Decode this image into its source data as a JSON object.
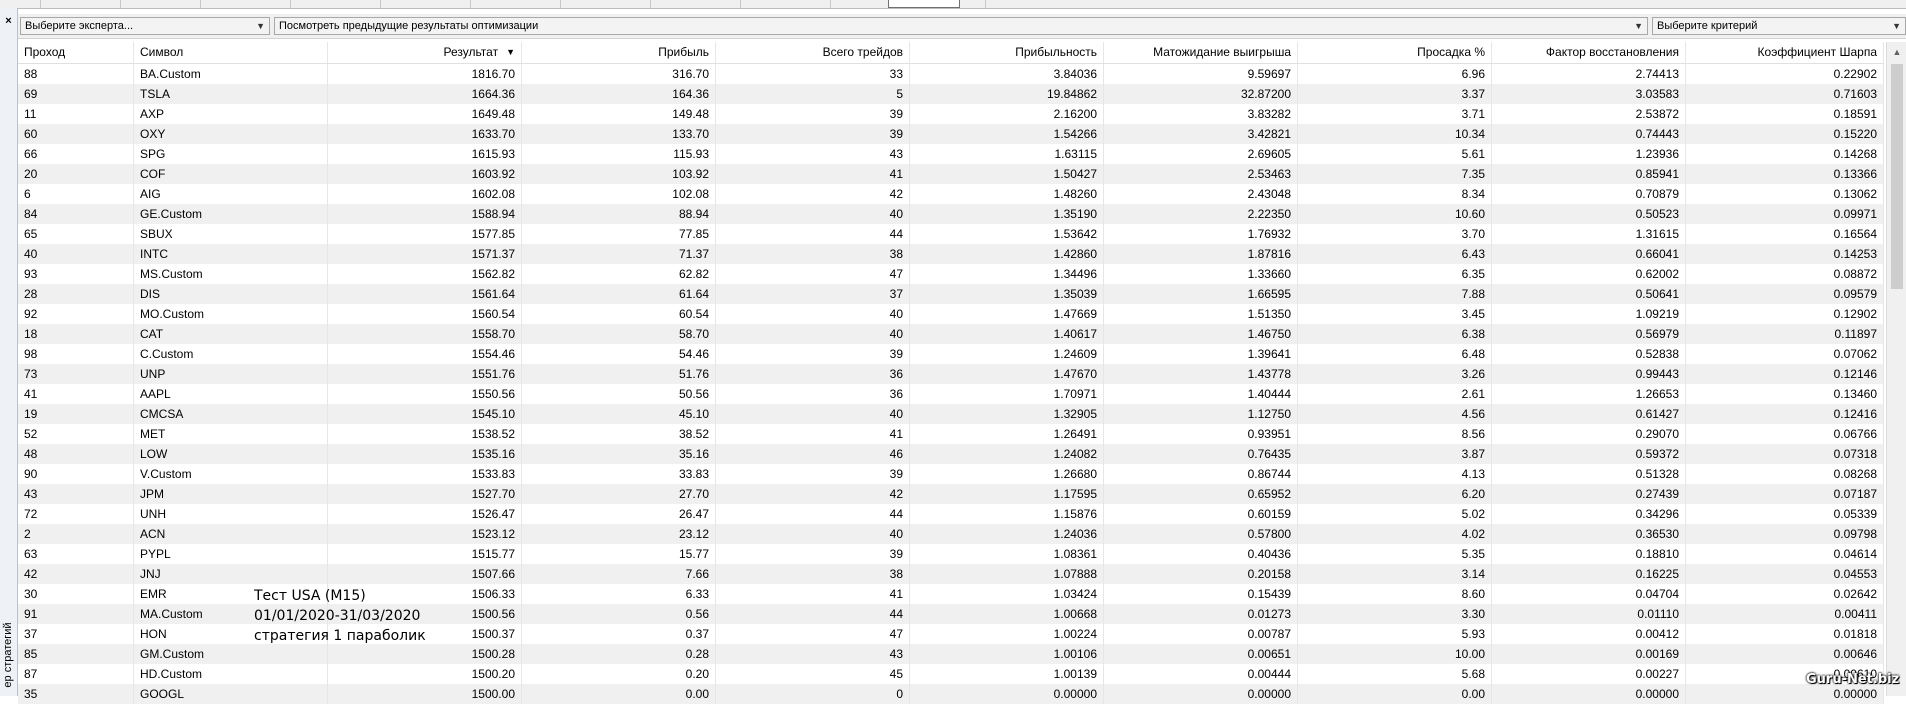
{
  "toolbar": {
    "expert_select": "Выберите эксперта...",
    "results_select": "Посмотреть предыдущие результаты оптимизации",
    "criterion_select": "Выберите критерий"
  },
  "left_panel": {
    "close_glyph": "×",
    "vertical_title": "ер стратегий"
  },
  "table": {
    "headers": [
      "Проход",
      "Символ",
      "Результат",
      "Прибыль",
      "Всего трейдов",
      "Прибыльность",
      "Матожидание выигрыша",
      "Просадка %",
      "Фактор восстановления",
      "Коэффициент Шарпа"
    ],
    "sort_indicator": "▼",
    "rows": [
      [
        "88",
        "BA.Custom",
        "1816.70",
        "316.70",
        "33",
        "3.84036",
        "9.59697",
        "6.96",
        "2.74413",
        "0.22902"
      ],
      [
        "69",
        "TSLA",
        "1664.36",
        "164.36",
        "5",
        "19.84862",
        "32.87200",
        "3.37",
        "3.03583",
        "0.71603"
      ],
      [
        "11",
        "AXP",
        "1649.48",
        "149.48",
        "39",
        "2.16200",
        "3.83282",
        "3.71",
        "2.53872",
        "0.18591"
      ],
      [
        "60",
        "OXY",
        "1633.70",
        "133.70",
        "39",
        "1.54266",
        "3.42821",
        "10.34",
        "0.74443",
        "0.15220"
      ],
      [
        "66",
        "SPG",
        "1615.93",
        "115.93",
        "43",
        "1.63115",
        "2.69605",
        "5.61",
        "1.23936",
        "0.14268"
      ],
      [
        "20",
        "COF",
        "1603.92",
        "103.92",
        "41",
        "1.50427",
        "2.53463",
        "7.35",
        "0.85941",
        "0.13366"
      ],
      [
        "6",
        "AIG",
        "1602.08",
        "102.08",
        "42",
        "1.48260",
        "2.43048",
        "8.34",
        "0.70879",
        "0.13062"
      ],
      [
        "84",
        "GE.Custom",
        "1588.94",
        "88.94",
        "40",
        "1.35190",
        "2.22350",
        "10.60",
        "0.50523",
        "0.09971"
      ],
      [
        "65",
        "SBUX",
        "1577.85",
        "77.85",
        "44",
        "1.53642",
        "1.76932",
        "3.70",
        "1.31615",
        "0.16564"
      ],
      [
        "40",
        "INTC",
        "1571.37",
        "71.37",
        "38",
        "1.42860",
        "1.87816",
        "6.43",
        "0.66041",
        "0.14253"
      ],
      [
        "93",
        "MS.Custom",
        "1562.82",
        "62.82",
        "47",
        "1.34496",
        "1.33660",
        "6.35",
        "0.62002",
        "0.08872"
      ],
      [
        "28",
        "DIS",
        "1561.64",
        "61.64",
        "37",
        "1.35039",
        "1.66595",
        "7.88",
        "0.50641",
        "0.09579"
      ],
      [
        "92",
        "MO.Custom",
        "1560.54",
        "60.54",
        "40",
        "1.47669",
        "1.51350",
        "3.45",
        "1.09219",
        "0.12902"
      ],
      [
        "18",
        "CAT",
        "1558.70",
        "58.70",
        "40",
        "1.40617",
        "1.46750",
        "6.38",
        "0.56979",
        "0.11897"
      ],
      [
        "98",
        "C.Custom",
        "1554.46",
        "54.46",
        "39",
        "1.24609",
        "1.39641",
        "6.48",
        "0.52838",
        "0.07062"
      ],
      [
        "73",
        "UNP",
        "1551.76",
        "51.76",
        "36",
        "1.47670",
        "1.43778",
        "3.26",
        "0.99443",
        "0.12146"
      ],
      [
        "41",
        "AAPL",
        "1550.56",
        "50.56",
        "36",
        "1.70971",
        "1.40444",
        "2.61",
        "1.26653",
        "0.13460"
      ],
      [
        "19",
        "CMCSA",
        "1545.10",
        "45.10",
        "40",
        "1.32905",
        "1.12750",
        "4.56",
        "0.61427",
        "0.12416"
      ],
      [
        "52",
        "MET",
        "1538.52",
        "38.52",
        "41",
        "1.26491",
        "0.93951",
        "8.56",
        "0.29070",
        "0.06766"
      ],
      [
        "48",
        "LOW",
        "1535.16",
        "35.16",
        "46",
        "1.24082",
        "0.76435",
        "3.87",
        "0.59372",
        "0.07318"
      ],
      [
        "90",
        "V.Custom",
        "1533.83",
        "33.83",
        "39",
        "1.26680",
        "0.86744",
        "4.13",
        "0.51328",
        "0.08268"
      ],
      [
        "43",
        "JPM",
        "1527.70",
        "27.70",
        "42",
        "1.17595",
        "0.65952",
        "6.20",
        "0.27439",
        "0.07187"
      ],
      [
        "72",
        "UNH",
        "1526.47",
        "26.47",
        "44",
        "1.15876",
        "0.60159",
        "5.02",
        "0.34296",
        "0.05339"
      ],
      [
        "2",
        "ACN",
        "1523.12",
        "23.12",
        "40",
        "1.24036",
        "0.57800",
        "4.02",
        "0.36530",
        "0.09798"
      ],
      [
        "63",
        "PYPL",
        "1515.77",
        "15.77",
        "39",
        "1.08361",
        "0.40436",
        "5.35",
        "0.18810",
        "0.04614"
      ],
      [
        "42",
        "JNJ",
        "1507.66",
        "7.66",
        "38",
        "1.07888",
        "0.20158",
        "3.14",
        "0.16225",
        "0.04553"
      ],
      [
        "30",
        "EMR",
        "1506.33",
        "6.33",
        "41",
        "1.03424",
        "0.15439",
        "8.60",
        "0.04704",
        "0.02642"
      ],
      [
        "91",
        "MA.Custom",
        "1500.56",
        "0.56",
        "44",
        "1.00668",
        "0.01273",
        "3.30",
        "0.01110",
        "0.00411"
      ],
      [
        "37",
        "HON",
        "1500.37",
        "0.37",
        "47",
        "1.00224",
        "0.00787",
        "5.93",
        "0.00412",
        "0.01818"
      ],
      [
        "85",
        "GM.Custom",
        "1500.28",
        "0.28",
        "43",
        "1.00106",
        "0.00651",
        "10.00",
        "0.00169",
        "0.00646"
      ],
      [
        "87",
        "HD.Custom",
        "1500.20",
        "0.20",
        "45",
        "1.00139",
        "0.00444",
        "5.68",
        "0.00227",
        "0.00610"
      ],
      [
        "35",
        "GOOGL",
        "1500.00",
        "0.00",
        "0",
        "0.00000",
        "0.00000",
        "0.00",
        "0.00000",
        "0.00000"
      ]
    ]
  },
  "overlay": {
    "line1": "Тест USA (M15)",
    "line2": "01/01/2020-31/03/2020",
    "line3": "стратегия 1 параболик"
  },
  "scrollbar": {
    "up_glyph": "▲"
  },
  "watermark": "Guru-Net.biz"
}
